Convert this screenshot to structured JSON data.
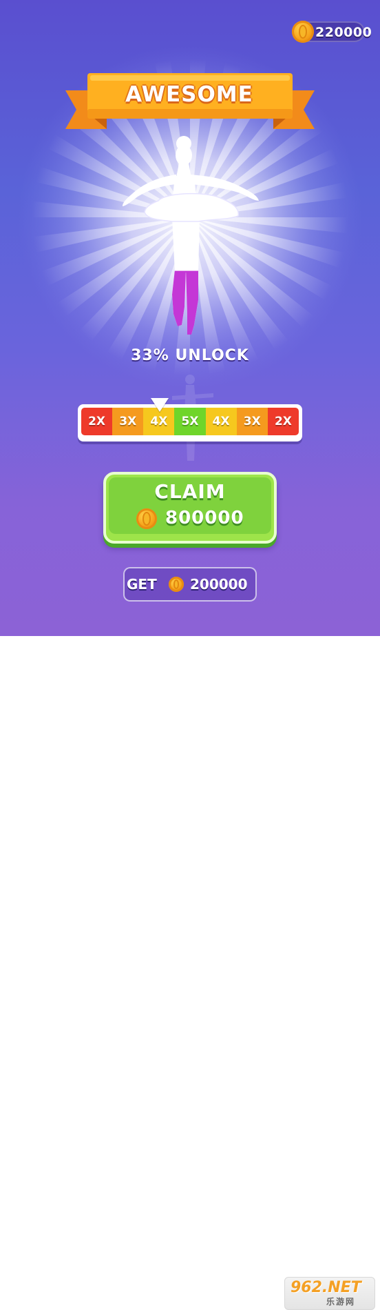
{
  "header": {
    "coin_total": "220000",
    "coin_icon": "gold-coin-icon"
  },
  "banner": {
    "title": "AWESOME",
    "color": "#ffa51f"
  },
  "progress": {
    "unlock_text": "33% UNLOCK",
    "unlock_fraction": 0.33,
    "fill_color": "#c437d6"
  },
  "multiplier": {
    "segments": [
      {
        "label": "2X",
        "color": "#ee3a2a"
      },
      {
        "label": "3X",
        "color": "#f59a1e"
      },
      {
        "label": "4X",
        "color": "#f6c81e"
      },
      {
        "label": "5X",
        "color": "#6fd52a"
      },
      {
        "label": "4X",
        "color": "#f6c81e"
      },
      {
        "label": "3X",
        "color": "#f59a1e"
      },
      {
        "label": "2X",
        "color": "#ee3a2a"
      }
    ],
    "selected_index": 2
  },
  "claim": {
    "label": "CLAIM",
    "amount": "800000"
  },
  "get": {
    "label": "GET",
    "amount": "200000"
  },
  "watermark": {
    "main": "962.NET",
    "sub": "乐游网"
  }
}
